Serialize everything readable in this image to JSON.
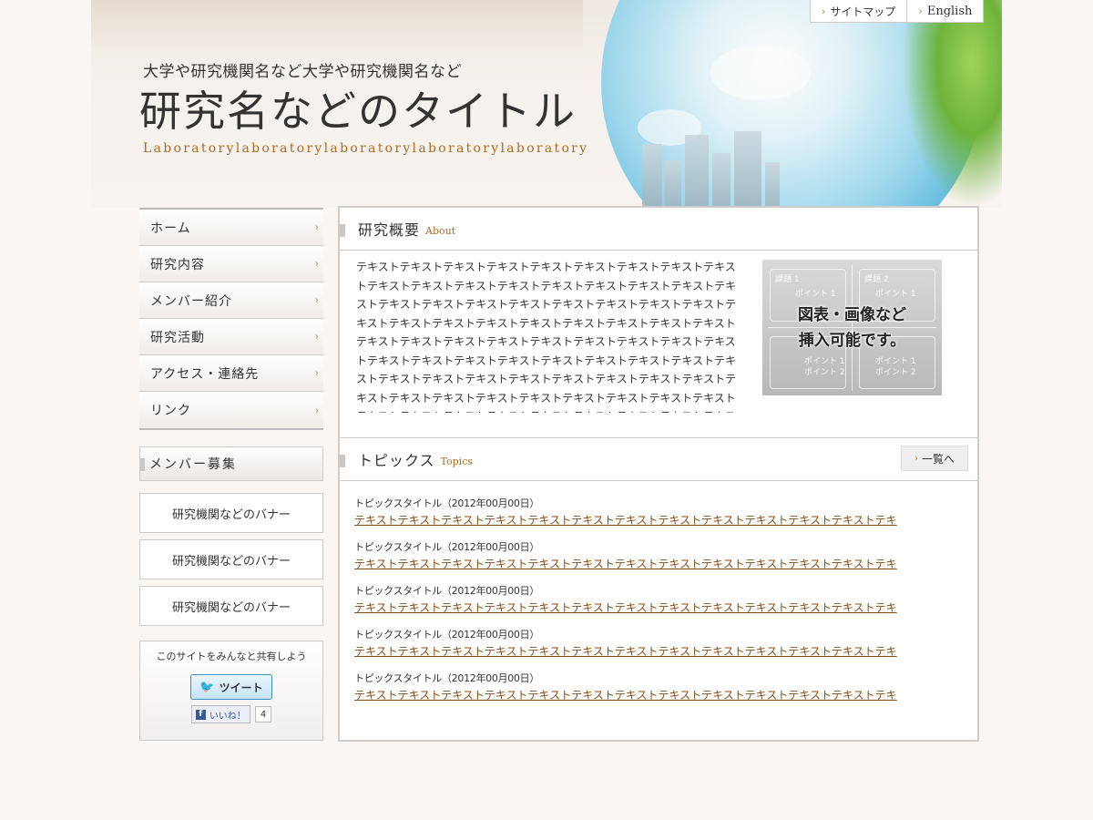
{
  "header": {
    "subtitle": "大学や研究機関名など大学や研究機関名など",
    "title": "研究名などのタイトル",
    "lab": "Laboratorylaboratorylaboratorylaboratorylaboratory",
    "links": [
      {
        "label": "サイトマップ"
      },
      {
        "label": "English"
      }
    ]
  },
  "nav": {
    "items": [
      {
        "label": "ホーム"
      },
      {
        "label": "研究内容"
      },
      {
        "label": "メンバー紹介"
      },
      {
        "label": "研究活動"
      },
      {
        "label": "アクセス・連絡先"
      },
      {
        "label": "リンク"
      }
    ]
  },
  "recruit": {
    "label": "メンバー募集"
  },
  "banners": [
    {
      "label": "研究機関などのバナー"
    },
    {
      "label": "研究機関などのバナー"
    },
    {
      "label": "研究機関などのバナー"
    }
  ],
  "share": {
    "text": "このサイトをみんなと共有しよう",
    "tweet_label": "ツイート",
    "like_label": "いいね！",
    "like_count": "4"
  },
  "about": {
    "title": "研究概要",
    "title_en": "About",
    "body": "テキストテキストテキストテキストテキストテキストテキストテキストテキストテキストテキストテキストテキストテキストテキストテキストテキストテキストテキストテキストテキストテキストテキストテキストテキストテキストテキストテキストテキストテキストテキストテキストテキストテキストテキストテキストテキストテキストテキストテキストテキストテキストテキストテキストテキストテキストテキストテキストテキストテキストテキストテキストテキストテキストテキストテキストテキストテキストテキストテキストテキストテキストテキストテキストテキストテキストテキストテキストテキストテキストテキストテキストテキストテキストテキストテキストテキストテキストテキストテキスト",
    "image": {
      "caption_line1": "図表・画像など",
      "caption_line2": "挿入可能です。",
      "box1": "課題 1",
      "box2": "課題 2",
      "point1": "ポイント 1",
      "point2": "ポイント 2"
    }
  },
  "topics": {
    "title": "トピックス",
    "title_en": "Topics",
    "more_label": "一覧へ",
    "items": [
      {
        "title": "トピックスタイトル（2012年00月00日）",
        "link": "テキストテキストテキストテキストテキストテキストテキストテキストテキストテキストテキストテキストテキ"
      },
      {
        "title": "トピックスタイトル（2012年00月00日）",
        "link": "テキストテキストテキストテキストテキストテキストテキストテキストテキストテキストテキストテキストテキ"
      },
      {
        "title": "トピックスタイトル（2012年00月00日）",
        "link": "テキストテキストテキストテキストテキストテキストテキストテキストテキストテキストテキストテキストテキ"
      },
      {
        "title": "トピックスタイトル（2012年00月00日）",
        "link": "テキストテキストテキストテキストテキストテキストテキストテキストテキストテキストテキストテキストテキ"
      },
      {
        "title": "トピックスタイトル（2012年00月00日）",
        "link": "テキストテキストテキストテキストテキストテキストテキストテキストテキストテキストテキストテキストテキ"
      }
    ]
  }
}
